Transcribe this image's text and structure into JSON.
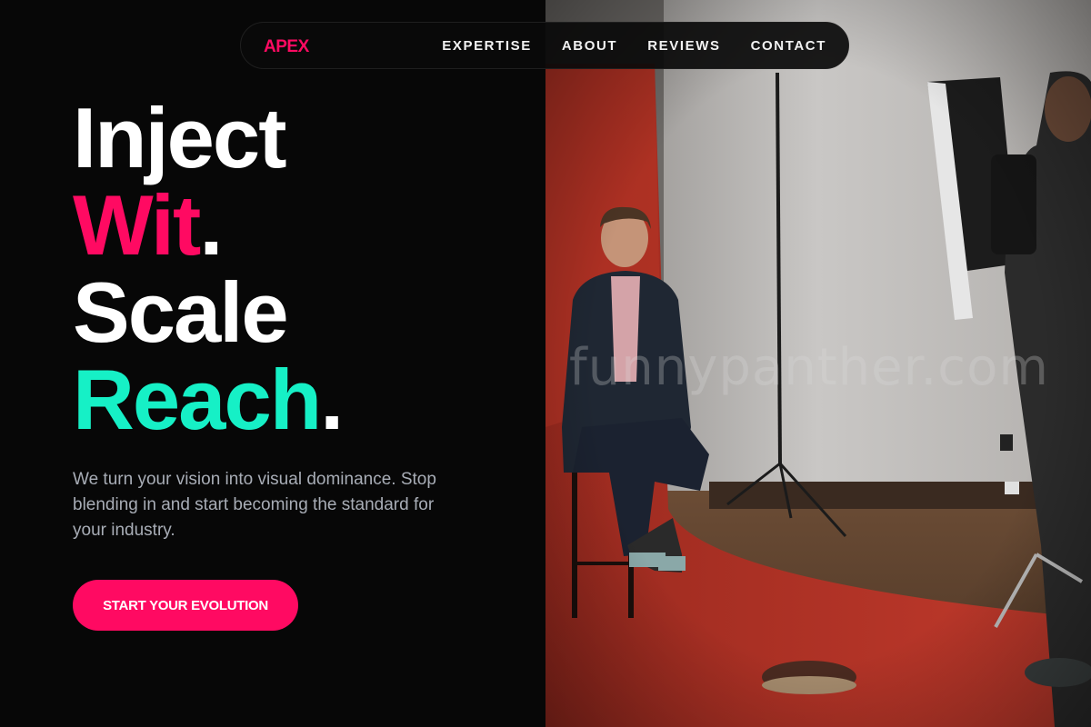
{
  "nav": {
    "logo": "APEX",
    "links": [
      "EXPERTISE",
      "ABOUT",
      "REVIEWS",
      "CONTACT"
    ]
  },
  "hero": {
    "line1": "Inject",
    "line2_word": "Wit",
    "line2_dot": ".",
    "line3": "Scale",
    "line4_word": "Reach",
    "line4_dot": ".",
    "subtext": "We turn your vision into visual dominance. Stop blending in and start becoming the standard for your industry.",
    "cta_label": "START YOUR EVOLUTION"
  },
  "photo": {
    "watermark": "funnypanther.com",
    "scene": "photo-studio-portrait"
  },
  "colors": {
    "background": "#070707",
    "accent_pink": "#ff0a62",
    "accent_teal": "#16f0c6",
    "subtext": "#a8adb6"
  }
}
